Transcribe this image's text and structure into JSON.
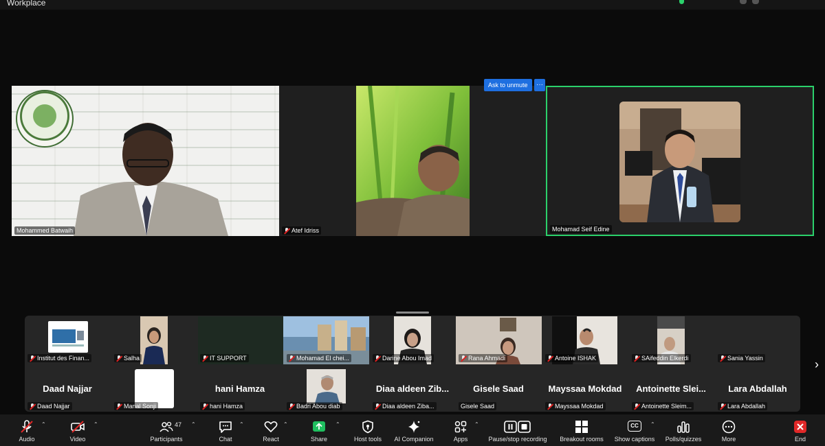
{
  "window": {
    "title": "Workplace"
  },
  "speaker_tiles": [
    {
      "name": "Mohammed Batwaih",
      "muted": false
    },
    {
      "name": "Atef Idriss",
      "muted": true
    },
    {
      "name": "Mohamad Seif Edine",
      "muted": false,
      "active_speaker": true
    }
  ],
  "tile_controls": {
    "ask_to_unmute": "Ask to unmute",
    "more": "···"
  },
  "gallery": {
    "row1": [
      {
        "name": "Institut des Finan..."
      },
      {
        "name": "Salha"
      },
      {
        "name": "IT SUPPORT"
      },
      {
        "name": "Mohamad El chei..."
      },
      {
        "name": "Darine Abou Imad"
      },
      {
        "name": "Rana Ahmadi"
      },
      {
        "name": "Antoine ISHAK"
      },
      {
        "name": "SAifeddin Elkerdi"
      },
      {
        "name": "Sania Yassin"
      }
    ],
    "row2": [
      {
        "display": "Daad Najjar",
        "name": "Daad Najjar"
      },
      {
        "display": "",
        "name": "Manal Sonji"
      },
      {
        "display": "hani Hamza",
        "name": "hani Hamza"
      },
      {
        "display": "",
        "name": "Badri Abou diab"
      },
      {
        "display": "Diaa aldeen Zib...",
        "name": "Diaa aldeen Ziba..."
      },
      {
        "display": "Gisele Saad",
        "name": "Gisele Saad"
      },
      {
        "display": "Mayssaa Mokdad",
        "name": "Mayssaa Mokdad"
      },
      {
        "display": "Antoinette Slei...",
        "name": "Antoinette Sleim..."
      },
      {
        "display": "Lara Abdallah",
        "name": "Lara Abdallah"
      }
    ],
    "next": "›"
  },
  "toolbar": {
    "audio": "Audio",
    "video": "Video",
    "participants": "Participants",
    "participant_count": "47",
    "chat": "Chat",
    "react": "React",
    "share": "Share",
    "host_tools": "Host tools",
    "ai_companion": "AI Companion",
    "apps": "Apps",
    "record": "Pause/stop recording",
    "breakout": "Breakout rooms",
    "captions": "Show captions",
    "captions_icon_text": "CC",
    "polls": "Polls/quizzes",
    "more": "More",
    "end": "End",
    "caret": "⌃"
  },
  "colors": {
    "active_speaker_border": "#2bd16b",
    "share_green": "#1fbf5f",
    "end_red": "#e02828",
    "accent_blue": "#1e6fe0"
  }
}
